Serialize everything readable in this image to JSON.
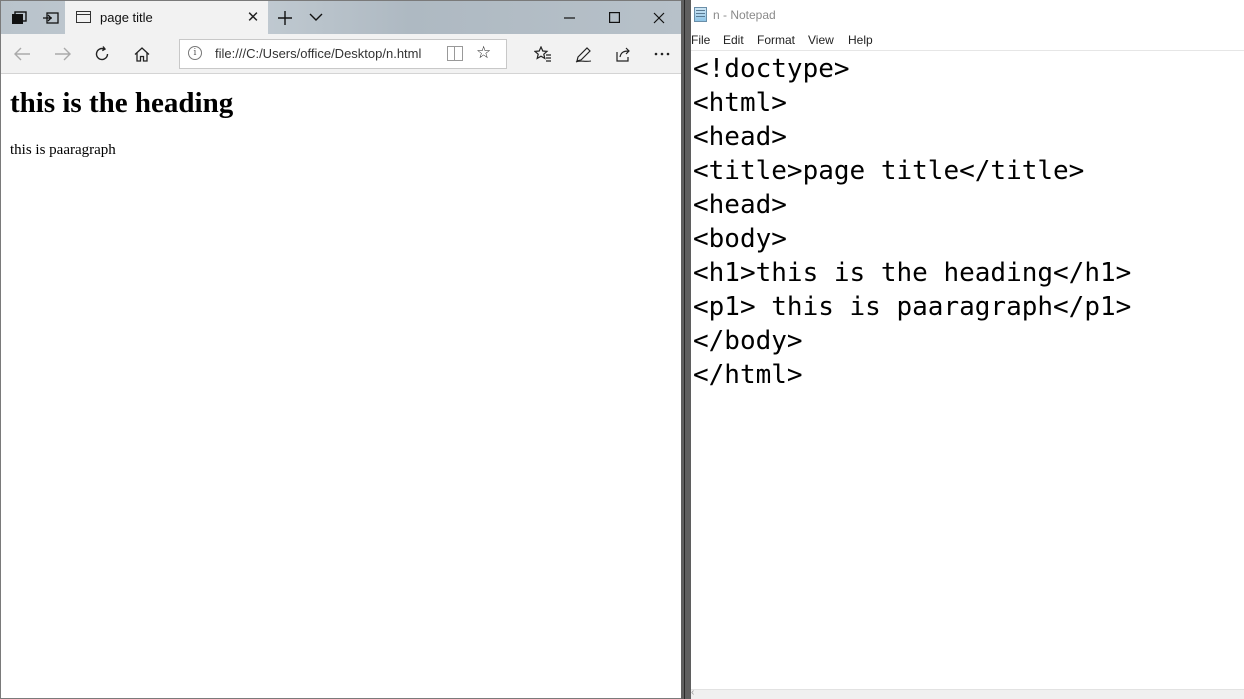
{
  "browser": {
    "tab": {
      "title": "page title"
    },
    "address": {
      "url": "file:///C:/Users/office/Desktop/n.html"
    },
    "page": {
      "heading": "this is the heading",
      "paragraph": "this is paaragraph"
    }
  },
  "notepad": {
    "title": "n - Notepad",
    "menu": [
      "File",
      "Edit",
      "Format",
      "View",
      "Help"
    ],
    "lines": [
      "<!doctype>",
      "<html>",
      "<head>",
      "<title>page title</title>",
      "<head>",
      "<body>",
      "<h1>this is the heading</h1>",
      "<p1> this is paaragraph</p1>",
      "</body>",
      "</html>"
    ]
  },
  "icons": {
    "tab_list": "tab-list-icon",
    "set_aside": "set-aside-tabs-icon",
    "tab_page": "page-icon",
    "close_tab": "close-icon",
    "new_tab": "plus-icon",
    "tab_preview": "chevron-down-icon",
    "minimize": "minimize-icon",
    "maximize": "maximize-icon",
    "close_window": "close-icon",
    "back": "arrow-left-icon",
    "forward": "arrow-right-icon",
    "refresh": "refresh-icon",
    "home": "home-icon",
    "info": "info-icon",
    "reading_view": "book-icon",
    "favorite": "star-icon",
    "favorites_list": "favorites-list-icon",
    "notes": "pen-icon",
    "share": "share-icon",
    "more": "more-icon",
    "notepad_app": "notepad-icon"
  }
}
